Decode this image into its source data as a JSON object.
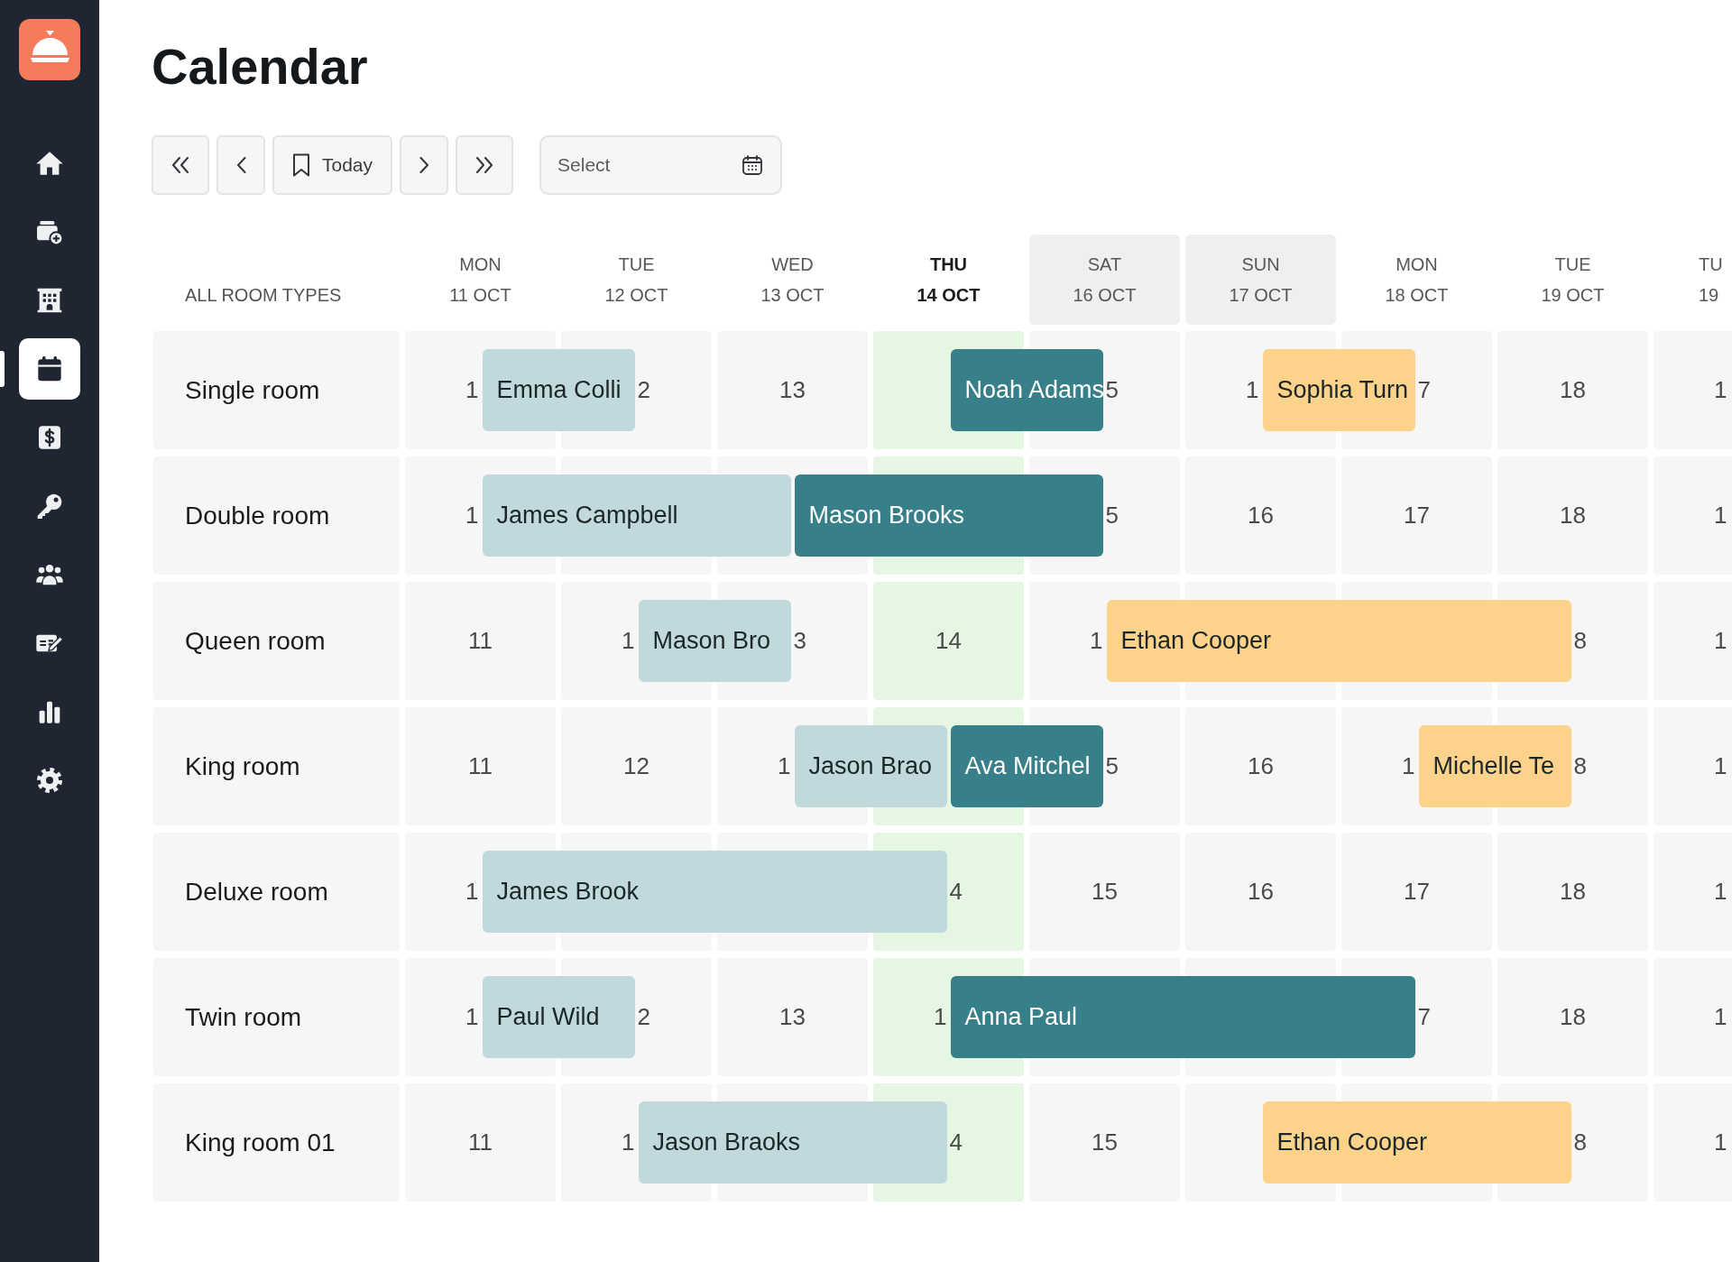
{
  "sidebar": {
    "items": [
      {
        "selected": false
      },
      {
        "selected": false
      },
      {
        "selected": false
      },
      {
        "selected": true
      },
      {
        "selected": false
      },
      {
        "selected": false
      },
      {
        "selected": false
      },
      {
        "selected": false
      },
      {
        "selected": false
      },
      {
        "selected": false
      }
    ]
  },
  "page_title": "Calendar",
  "toolbar": {
    "buttons": [
      {
        "kind": "first"
      },
      {
        "kind": "previous"
      },
      {
        "kind": "today",
        "label": "Today"
      },
      {
        "kind": "next"
      },
      {
        "kind": "last"
      }
    ],
    "date_picker": {
      "placeholder": "Select"
    }
  },
  "calendar": {
    "corner_label": "ALL ROOM TYPES",
    "columns": [
      {
        "day": "MON",
        "date": "11 OCT",
        "today": false,
        "weekend": false
      },
      {
        "day": "TUE",
        "date": "12 OCT",
        "today": false,
        "weekend": false
      },
      {
        "day": "WED",
        "date": "13 OCT",
        "today": false,
        "weekend": false
      },
      {
        "day": "THU",
        "date": "14 OCT",
        "today": true,
        "weekend": false
      },
      {
        "day": "SAT",
        "date": "16 OCT",
        "today": false,
        "weekend": true
      },
      {
        "day": "SUN",
        "date": "17 OCT",
        "today": false,
        "weekend": true
      },
      {
        "day": "MON",
        "date": "18 OCT",
        "today": false,
        "weekend": false
      },
      {
        "day": "TUE",
        "date": "19 OCT",
        "today": false,
        "weekend": false
      },
      {
        "day": "TU",
        "date": "19",
        "today": false,
        "weekend": false
      }
    ],
    "rows": [
      {
        "room": "Single room",
        "cells": [
          {
            "number": "1",
            "am_booked": false,
            "pm_booked": true,
            "booking": {
              "guest": "Emma Colli",
              "color": "#c1d9dd"
            }
          },
          {
            "number": "2",
            "am_booked": true,
            "pm_booked": false
          },
          {
            "number": "13",
            "am_booked": false,
            "pm_booked": false
          },
          {
            "am_booked": false,
            "pm_booked": true,
            "booking": {
              "guest": "Noah Adams",
              "color": "#377f89"
            }
          },
          {
            "number": "5",
            "am_booked": true,
            "pm_booked": false
          },
          {
            "number": "1",
            "am_booked": false,
            "pm_booked": true,
            "booking": {
              "guest": "Sophia Turn",
              "color": "#fdd28a"
            }
          },
          {
            "number": "7",
            "am_booked": true,
            "pm_booked": false
          },
          {
            "number": "18",
            "am_booked": false,
            "pm_booked": false
          },
          {
            "number": "1",
            "am_booked": false,
            "pm_booked": false
          }
        ]
      },
      {
        "room": "Double room",
        "cells": [
          {
            "number": "1",
            "am_booked": false,
            "pm_booked": true,
            "booking": {
              "guest": "James Campbell",
              "color": "#c1d9dd"
            }
          },
          {
            "am_booked": true,
            "pm_booked": true
          },
          {
            "am_booked": true,
            "pm_booked": true,
            "booking": {
              "guest": "Mason Brooks",
              "color": "#377f89"
            }
          },
          {
            "am_booked": true,
            "pm_booked": true
          },
          {
            "number": "5",
            "am_booked": true,
            "pm_booked": false
          },
          {
            "number": "16",
            "am_booked": false,
            "pm_booked": false
          },
          {
            "number": "17",
            "am_booked": false,
            "pm_booked": false
          },
          {
            "number": "18",
            "am_booked": false,
            "pm_booked": false
          },
          {
            "number": "1",
            "am_booked": false,
            "pm_booked": false
          }
        ]
      },
      {
        "room": "Queen room",
        "cells": [
          {
            "number": "11",
            "am_booked": false,
            "pm_booked": false
          },
          {
            "number": "1",
            "am_booked": false,
            "pm_booked": true,
            "booking": {
              "guest": "Mason Bro",
              "color": "#c1d9dd"
            }
          },
          {
            "number": "3",
            "am_booked": true,
            "pm_booked": false
          },
          {
            "number": "14",
            "am_booked": false,
            "pm_booked": false
          },
          {
            "number": "1",
            "am_booked": false,
            "pm_booked": true,
            "booking": {
              "guest": "Ethan Cooper",
              "color": "#fdd28a"
            }
          },
          {
            "am_booked": true,
            "pm_booked": true
          },
          {
            "am_booked": true,
            "pm_booked": true
          },
          {
            "number": "8",
            "am_booked": true,
            "pm_booked": false
          },
          {
            "number": "1",
            "am_booked": false,
            "pm_booked": false
          }
        ]
      },
      {
        "room": "King room",
        "cells": [
          {
            "number": "11",
            "am_booked": false,
            "pm_booked": false
          },
          {
            "number": "12",
            "am_booked": false,
            "pm_booked": false
          },
          {
            "number": "1",
            "am_booked": false,
            "pm_booked": true,
            "booking": {
              "guest": "Jason Brao",
              "color": "#c1d9dd"
            }
          },
          {
            "am_booked": true,
            "pm_booked": true,
            "booking": {
              "guest": "Ava Mitchel",
              "color": "#377f89"
            }
          },
          {
            "number": "5",
            "am_booked": true,
            "pm_booked": false
          },
          {
            "number": "16",
            "am_booked": false,
            "pm_booked": false
          },
          {
            "number": "1",
            "am_booked": false,
            "pm_booked": true,
            "booking": {
              "guest": "Michelle Te",
              "color": "#fdd28a"
            }
          },
          {
            "number": "8",
            "am_booked": true,
            "pm_booked": false
          },
          {
            "number": "1",
            "am_booked": false,
            "pm_booked": false
          }
        ]
      },
      {
        "room": "Deluxe room",
        "cells": [
          {
            "number": "1",
            "am_booked": false,
            "pm_booked": true,
            "booking": {
              "guest": "James Brook",
              "color": "#c1d9dd"
            }
          },
          {
            "am_booked": true,
            "pm_booked": true
          },
          {
            "am_booked": true,
            "pm_booked": true
          },
          {
            "number": "4",
            "am_booked": true,
            "pm_booked": false
          },
          {
            "number": "15",
            "am_booked": false,
            "pm_booked": false
          },
          {
            "number": "16",
            "am_booked": false,
            "pm_booked": false
          },
          {
            "number": "17",
            "am_booked": false,
            "pm_booked": false
          },
          {
            "number": "18",
            "am_booked": false,
            "pm_booked": false
          },
          {
            "number": "1",
            "am_booked": false,
            "pm_booked": false
          }
        ]
      },
      {
        "room": "Twin room",
        "cells": [
          {
            "number": "1",
            "am_booked": false,
            "pm_booked": true,
            "booking": {
              "guest": "Paul Wild",
              "color": "#c1d9dd"
            }
          },
          {
            "number": "2",
            "am_booked": true,
            "pm_booked": false
          },
          {
            "number": "13",
            "am_booked": false,
            "pm_booked": false
          },
          {
            "number": "1",
            "am_booked": false,
            "pm_booked": true,
            "booking": {
              "guest": "Anna Paul",
              "color": "#377f89"
            }
          },
          {
            "am_booked": true,
            "pm_booked": true
          },
          {
            "am_booked": true,
            "pm_booked": true
          },
          {
            "number": "7",
            "am_booked": true,
            "pm_booked": false
          },
          {
            "number": "18",
            "am_booked": false,
            "pm_booked": false
          },
          {
            "number": "1",
            "am_booked": false,
            "pm_booked": false
          }
        ]
      },
      {
        "room": "King room 01",
        "cells": [
          {
            "number": "11",
            "am_booked": false,
            "pm_booked": false
          },
          {
            "number": "1",
            "am_booked": false,
            "pm_booked": true,
            "booking": {
              "guest": "Jason Braoks",
              "color": "#c1d9dd"
            }
          },
          {
            "am_booked": true,
            "pm_booked": true
          },
          {
            "number": "4",
            "am_booked": true,
            "pm_booked": false
          },
          {
            "number": "15",
            "am_booked": false,
            "pm_booked": false
          },
          {
            "am_booked": false,
            "pm_booked": true,
            "booking": {
              "guest": "Ethan Cooper",
              "color": "#fdd28a"
            }
          },
          {
            "am_booked": true,
            "pm_booked": true
          },
          {
            "number": "8",
            "am_booked": true,
            "pm_booked": false
          },
          {
            "number": "1",
            "am_booked": false,
            "pm_booked": false
          }
        ]
      }
    ]
  }
}
